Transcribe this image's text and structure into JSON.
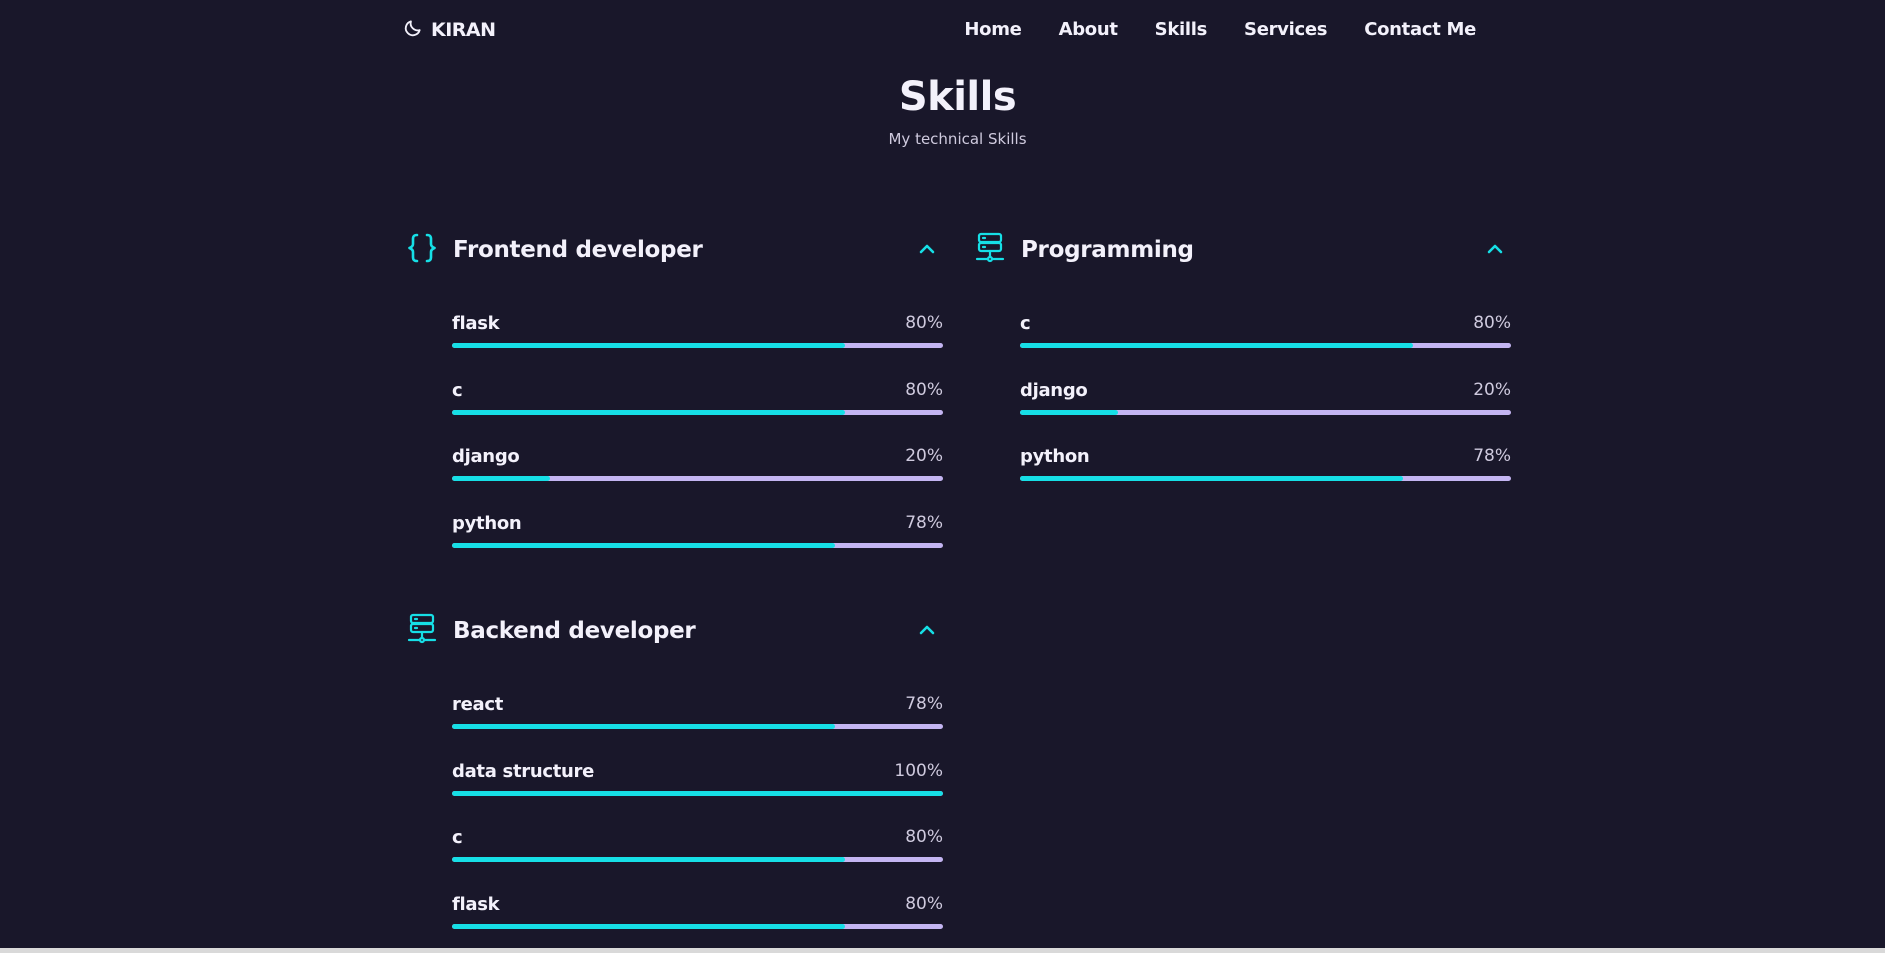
{
  "header": {
    "brand": "KIRAN",
    "nav": [
      "Home",
      "About",
      "Skills",
      "Services",
      "Contact Me"
    ]
  },
  "section": {
    "title": "Skills",
    "subtitle": "My technical Skills"
  },
  "groups": [
    {
      "title": "Frontend developer",
      "icon": "code-braces-icon",
      "skills": [
        {
          "name": "flask",
          "percent_label": "80%",
          "value": 80
        },
        {
          "name": "c",
          "percent_label": "80%",
          "value": 80
        },
        {
          "name": "django",
          "percent_label": "20%",
          "value": 20
        },
        {
          "name": "python",
          "percent_label": "78%",
          "value": 78
        }
      ]
    },
    {
      "title": "Backend developer",
      "icon": "server-network-icon",
      "skills": [
        {
          "name": "react",
          "percent_label": "78%",
          "value": 78
        },
        {
          "name": "data structure",
          "percent_label": "100%",
          "value": 100
        },
        {
          "name": "c",
          "percent_label": "80%",
          "value": 80
        },
        {
          "name": "flask",
          "percent_label": "80%",
          "value": 80
        }
      ]
    },
    {
      "title": "Programming",
      "icon": "server-network-icon",
      "skills": [
        {
          "name": "c",
          "percent_label": "80%",
          "value": 80
        },
        {
          "name": "django",
          "percent_label": "20%",
          "value": 20
        },
        {
          "name": "python",
          "percent_label": "78%",
          "value": 78
        }
      ]
    }
  ],
  "colors": {
    "background": "#19172a",
    "accent": "#16dfe6",
    "bar_track": "#c4b5f2",
    "text": "#f3f1fb"
  }
}
